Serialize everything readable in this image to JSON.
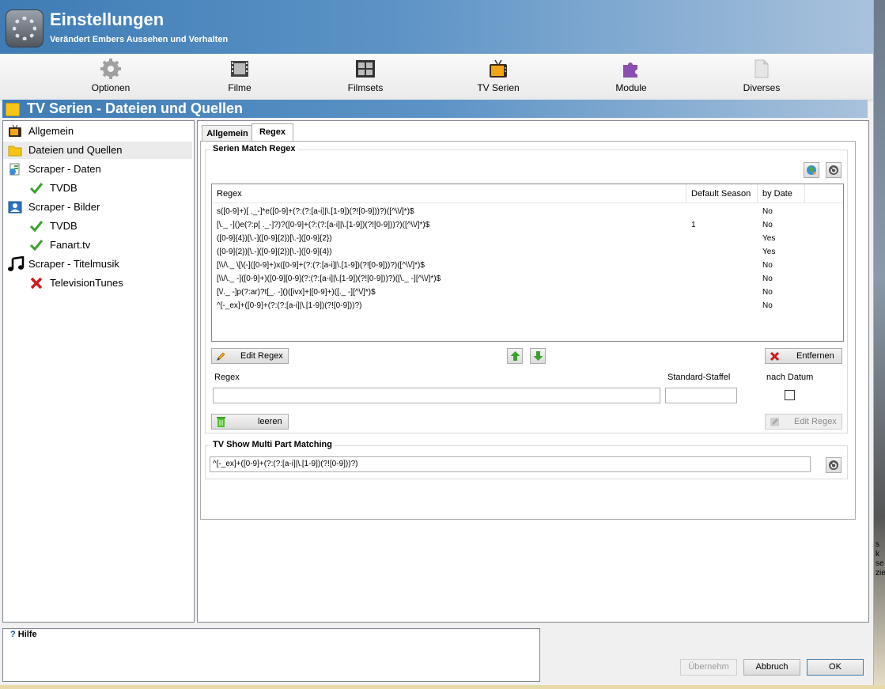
{
  "header": {
    "title": "Einstellungen",
    "subtitle": "Verändert Embers Aussehen und Verhalten"
  },
  "toolbar": {
    "items": [
      {
        "label": "Optionen",
        "icon": "gear-icon"
      },
      {
        "label": "Filme",
        "icon": "film-icon"
      },
      {
        "label": "Filmsets",
        "icon": "filmsets-icon"
      },
      {
        "label": "TV Serien",
        "icon": "tv-icon"
      },
      {
        "label": "Module",
        "icon": "puzzle-icon"
      },
      {
        "label": "Diverses",
        "icon": "document-icon"
      }
    ]
  },
  "section": {
    "title": "TV Serien - Dateien und Quellen"
  },
  "tree": {
    "items": [
      {
        "label": "Allgemein",
        "icon": "tv-icon"
      },
      {
        "label": "Dateien und Quellen",
        "icon": "folder-icon",
        "selected": true
      },
      {
        "label": "Scraper - Daten",
        "icon": "scraper-data-icon"
      },
      {
        "label": "TVDB",
        "icon": "check-icon"
      },
      {
        "label": "Scraper - Bilder",
        "icon": "scraper-images-icon"
      },
      {
        "label": "TVDB",
        "icon": "check-icon"
      },
      {
        "label": "Fanart.tv",
        "icon": "check-icon"
      },
      {
        "label": "Scraper - Titelmusik",
        "icon": "music-note-icon"
      },
      {
        "label": "TelevisionTunes",
        "icon": "cross-icon"
      }
    ]
  },
  "tabs": [
    {
      "label": "Allgemein",
      "active": false
    },
    {
      "label": "Regex",
      "active": true
    }
  ],
  "series_match": {
    "group_title": "Serien Match Regex",
    "columns": [
      "Regex",
      "Default Season",
      "by Date"
    ],
    "rows": [
      {
        "regex": "s([0-9]+)[ ._-]*e([0-9]+(?:(?:[a-i]|\\.[1-9])(?![0-9]))?)([^\\\\/]*)$",
        "season": "",
        "by_date": "No"
      },
      {
        "regex": "[\\._ -]()e(?:p[ ._-]?)?([0-9]+(?:(?:[a-i]|\\.[1-9])(?![0-9]))?)([^\\\\/]*)$",
        "season": "1",
        "by_date": "No"
      },
      {
        "regex": "([0-9]{4})[\\.-]([0-9]{2})[\\.-]([0-9]{2})",
        "season": "",
        "by_date": "Yes"
      },
      {
        "regex": "([0-9]{2})[\\.-]([0-9]{2})[\\.-]([0-9]{4})",
        "season": "",
        "by_date": "Yes"
      },
      {
        "regex": "[\\\\/\\._ \\[\\(-]([0-9]+)x([0-9]+(?:(?:[a-i]|\\.[1-9])(?![0-9]))?)([^\\\\/]*)$",
        "season": "",
        "by_date": "No"
      },
      {
        "regex": "[\\\\/\\._ -]([0-9]+)([0-9][0-9](?:(?:[a-i]|\\.[1-9])(?![0-9]))?)([\\._ -][^\\\\/]*)$",
        "season": "",
        "by_date": "No"
      },
      {
        "regex": "[\\/._ -]p(?:ar)?t[_. -]()([ivx]+|[0-9]+)([._ -][^\\/]*)$",
        "season": "",
        "by_date": "No"
      },
      {
        "regex": "^[-_ex]+([0-9]+(?:(?:[a-i]|\\.[1-9])(?![0-9]))?)",
        "season": "",
        "by_date": "No"
      }
    ],
    "edit_regex_label": "Edit Regex",
    "remove_label": "Entfernen",
    "form": {
      "regex_label": "Regex",
      "season_label": "Standard-Staffel",
      "by_date_label": "nach Datum",
      "regex_value": "",
      "season_value": ""
    },
    "clear_label": "leeren",
    "edit_regex_disabled_label": "Edit Regex"
  },
  "multipart": {
    "group_title": "TV Show Multi Part Matching",
    "value": "^[-_ex]+([0-9]+(?:(?:[a-i]|\\.[1-9])(?![0-9]))?)"
  },
  "help": {
    "title": "Hilfe"
  },
  "footer": {
    "apply_label": "Übernehm",
    "cancel_label": "Abbruch",
    "ok_label": "OK"
  },
  "desktop_edge_text": "s k se zie"
}
